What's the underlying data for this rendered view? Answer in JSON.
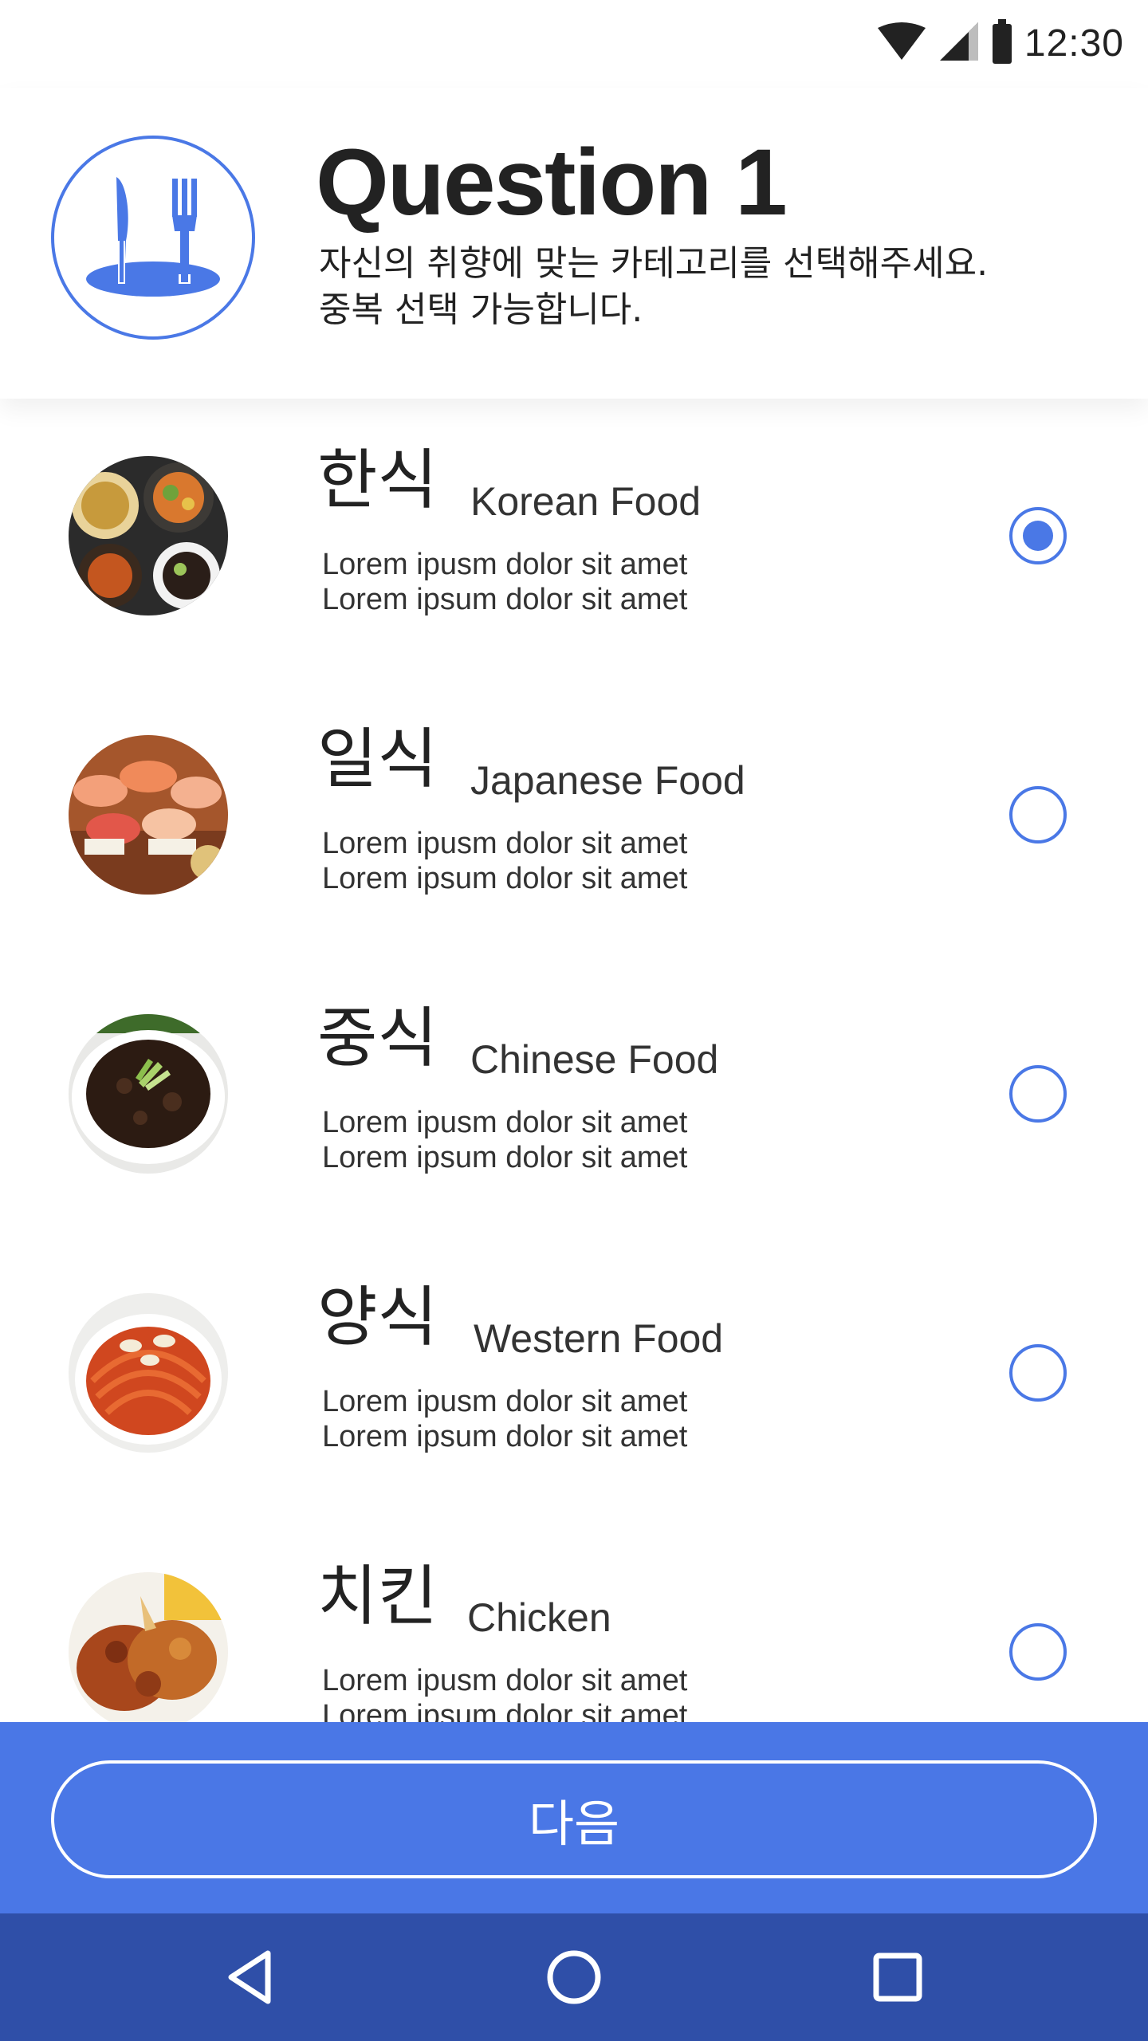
{
  "status_bar": {
    "time": "12:30",
    "icons": [
      "wifi-icon",
      "cell-signal-icon",
      "battery-icon"
    ]
  },
  "header": {
    "icon": "restaurant-icon",
    "title": "Question 1",
    "subtitle_line1": "자신의 취향에 맞는 카테고리를 선택해주세요.",
    "subtitle_line2": "중복 선택 가능합니다."
  },
  "foods": [
    {
      "name_ko": "한식",
      "name_en": "Korean Food",
      "desc_line1": "Lorem ipusm dolor sit amet",
      "desc_line2": "Lorem ipsum dolor sit amet",
      "selected": true,
      "image": "korean-food-photo"
    },
    {
      "name_ko": "일식",
      "name_en": "Japanese Food",
      "desc_line1": "Lorem ipusm dolor sit amet",
      "desc_line2": "Lorem ipsum dolor sit amet",
      "selected": false,
      "image": "japanese-food-photo"
    },
    {
      "name_ko": "중식",
      "name_en": "Chinese Food",
      "desc_line1": "Lorem ipusm dolor sit amet",
      "desc_line2": "Lorem ipsum dolor sit amet",
      "selected": false,
      "image": "chinese-food-photo"
    },
    {
      "name_ko": "양식",
      "name_en": "Western Food",
      "desc_line1": "Lorem ipusm dolor sit amet",
      "desc_line2": "Lorem ipsum dolor sit amet",
      "selected": false,
      "image": "western-food-photo"
    },
    {
      "name_ko": "치킨",
      "name_en": "Chicken",
      "desc_line1": "Lorem ipusm dolor sit amet",
      "desc_line2": "Lorem ipsum dolor sit amet",
      "selected": false,
      "image": "chicken-photo"
    }
  ],
  "action": {
    "next_label": "다음"
  },
  "nav": {
    "icons": [
      "back-icon",
      "home-icon",
      "recents-icon"
    ]
  },
  "colors": {
    "accent": "#4a78e6",
    "action_bar": "#4a77e6",
    "nav_bar": "#2f4fa8",
    "text": "#222222"
  }
}
